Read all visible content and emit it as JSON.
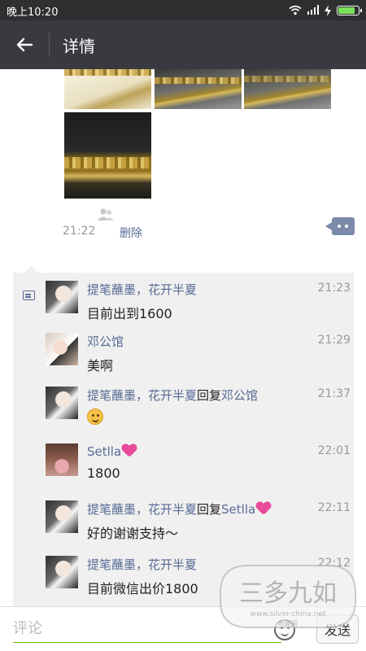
{
  "status_bar": {
    "time": "晚上10:20",
    "battery_level": 0.85
  },
  "header": {
    "title": "详情",
    "back_icon": "arrow-left-icon"
  },
  "post": {
    "time": "21:22",
    "delete_label": "删除",
    "visibility_icon": "people-icon",
    "comment_icon": "comment-dots-icon"
  },
  "comments": [
    {
      "author": "提笔蘸墨，花开半夏",
      "reply_word": "",
      "reply_to": "",
      "time": "21:23",
      "text": "目前出到1600",
      "avatar": "avatar-woman-dark-hair"
    },
    {
      "author": "邓公馆",
      "reply_word": "",
      "reply_to": "",
      "time": "21:29",
      "text": "美啊",
      "avatar": "avatar-cartoon-girl"
    },
    {
      "author": "提笔蘸墨，花开半夏",
      "reply_word": "回复",
      "reply_to": "邓公馆",
      "time": "21:37",
      "text": "",
      "emoji": "smile-emoji",
      "avatar": "avatar-woman-dark-hair"
    },
    {
      "author": "Setlla",
      "reply_word": "",
      "reply_to": "",
      "time": "22:01",
      "text": "1800",
      "author_badge": "pink-heart-icon",
      "avatar": "avatar-cake-photo"
    },
    {
      "author": "提笔蘸墨，花开半夏",
      "reply_word": "回复",
      "reply_to": "Setlla",
      "time": "22:11",
      "text": "好的谢谢支持～",
      "reply_badge": "pink-heart-icon",
      "avatar": "avatar-woman-dark-hair"
    },
    {
      "author": "提笔蘸墨，花开半夏",
      "reply_word": "",
      "reply_to": "",
      "time": "22:12",
      "text": "目前微信出价1800",
      "avatar": "avatar-woman-dark-hair"
    }
  ],
  "input": {
    "placeholder": "评论",
    "emoji_icon": "smile-icon",
    "send_label": "发送"
  },
  "watermark": {
    "title": "三多九如",
    "url": "www.silver-china.net",
    "subtitle": "收藏网"
  },
  "colors": {
    "link_blue": "#576b95",
    "header_bg": "#393a3f",
    "comment_bg": "#f0f0f0",
    "input_underline": "#62b900",
    "heart_pink": "#e84b9b"
  }
}
